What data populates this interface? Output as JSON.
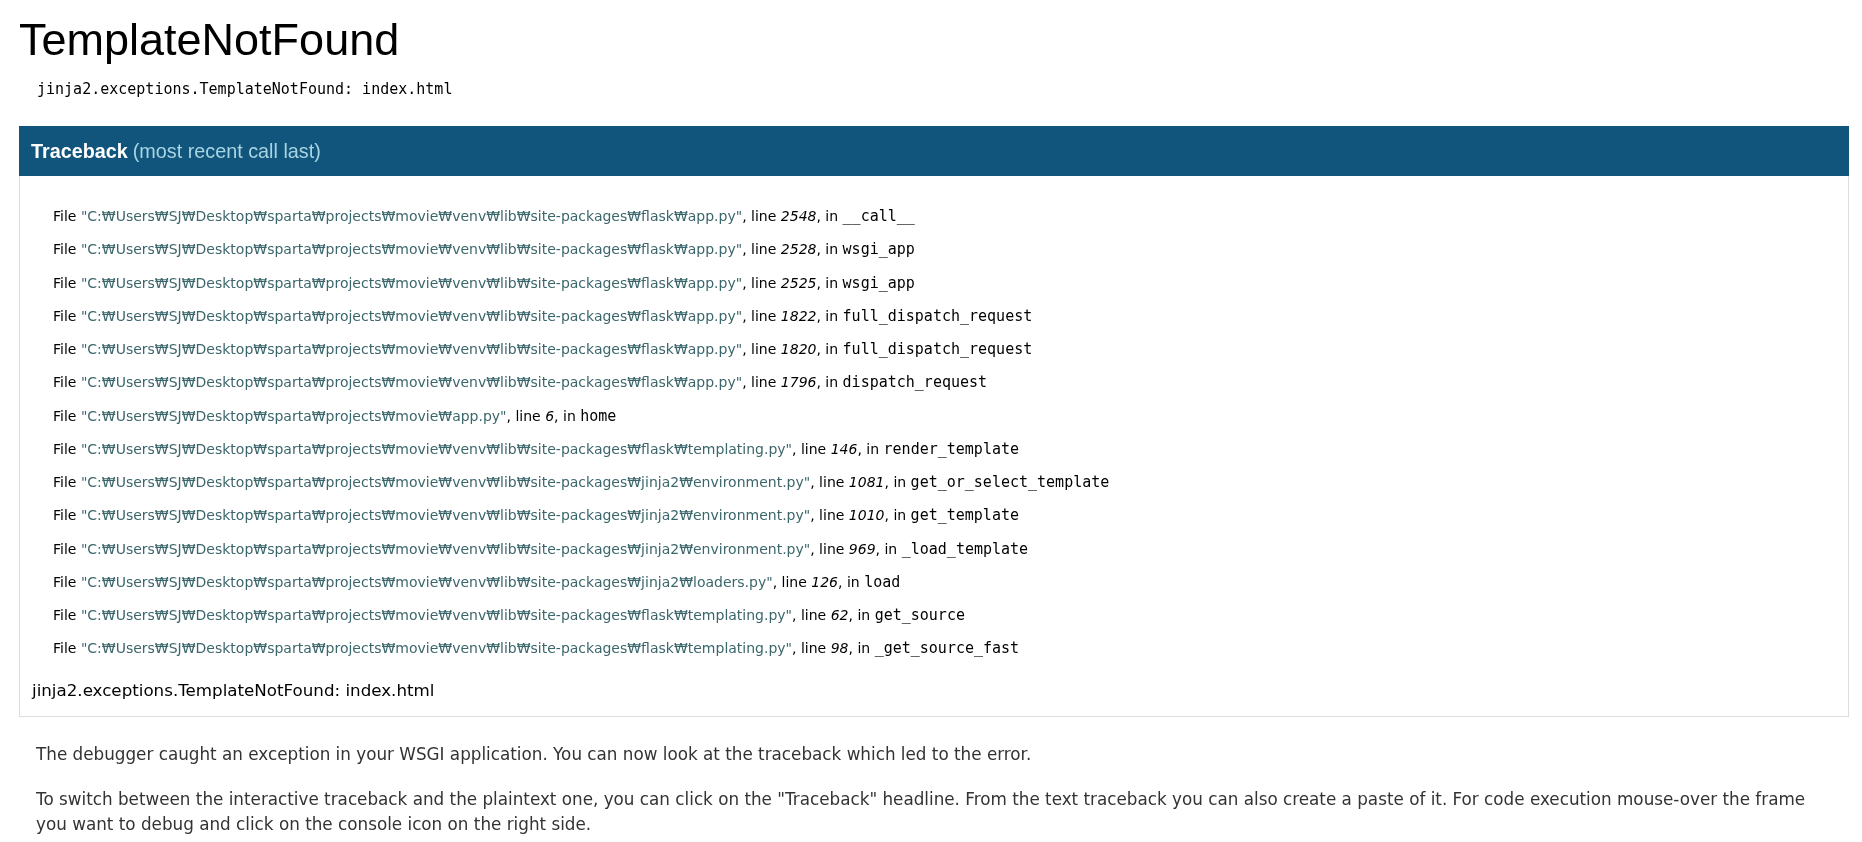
{
  "title": "TemplateNotFound",
  "message": "jinja2.exceptions.TemplateNotFound: index.html",
  "traceback": {
    "heading": "Traceback",
    "heading_note": "(most recent call last)",
    "frames": [
      {
        "file_label": "File",
        "path": "\"C:₩Users₩SJ₩Desktop₩sparta₩projects₩movie₩venv₩lib₩site-packages₩flask₩app.py\"",
        "line_label": ", line",
        "line": "2548",
        "in_label": ", in",
        "function": "__call__"
      },
      {
        "file_label": "File",
        "path": "\"C:₩Users₩SJ₩Desktop₩sparta₩projects₩movie₩venv₩lib₩site-packages₩flask₩app.py\"",
        "line_label": ", line",
        "line": "2528",
        "in_label": ", in",
        "function": "wsgi_app"
      },
      {
        "file_label": "File",
        "path": "\"C:₩Users₩SJ₩Desktop₩sparta₩projects₩movie₩venv₩lib₩site-packages₩flask₩app.py\"",
        "line_label": ", line",
        "line": "2525",
        "in_label": ", in",
        "function": "wsgi_app"
      },
      {
        "file_label": "File",
        "path": "\"C:₩Users₩SJ₩Desktop₩sparta₩projects₩movie₩venv₩lib₩site-packages₩flask₩app.py\"",
        "line_label": ", line",
        "line": "1822",
        "in_label": ", in",
        "function": "full_dispatch_request"
      },
      {
        "file_label": "File",
        "path": "\"C:₩Users₩SJ₩Desktop₩sparta₩projects₩movie₩venv₩lib₩site-packages₩flask₩app.py\"",
        "line_label": ", line",
        "line": "1820",
        "in_label": ", in",
        "function": "full_dispatch_request"
      },
      {
        "file_label": "File",
        "path": "\"C:₩Users₩SJ₩Desktop₩sparta₩projects₩movie₩venv₩lib₩site-packages₩flask₩app.py\"",
        "line_label": ", line",
        "line": "1796",
        "in_label": ", in",
        "function": "dispatch_request"
      },
      {
        "file_label": "File",
        "path": "\"C:₩Users₩SJ₩Desktop₩sparta₩projects₩movie₩app.py\"",
        "line_label": ", line",
        "line": "6",
        "in_label": ", in",
        "function": "home"
      },
      {
        "file_label": "File",
        "path": "\"C:₩Users₩SJ₩Desktop₩sparta₩projects₩movie₩venv₩lib₩site-packages₩flask₩templating.py\"",
        "line_label": ", line",
        "line": "146",
        "in_label": ", in",
        "function": "render_template"
      },
      {
        "file_label": "File",
        "path": "\"C:₩Users₩SJ₩Desktop₩sparta₩projects₩movie₩venv₩lib₩site-packages₩jinja2₩environment.py\"",
        "line_label": ", line",
        "line": "1081",
        "in_label": ", in",
        "function": "get_or_select_template"
      },
      {
        "file_label": "File",
        "path": "\"C:₩Users₩SJ₩Desktop₩sparta₩projects₩movie₩venv₩lib₩site-packages₩jinja2₩environment.py\"",
        "line_label": ", line",
        "line": "1010",
        "in_label": ", in",
        "function": "get_template"
      },
      {
        "file_label": "File",
        "path": "\"C:₩Users₩SJ₩Desktop₩sparta₩projects₩movie₩venv₩lib₩site-packages₩jinja2₩environment.py\"",
        "line_label": ", line",
        "line": "969",
        "in_label": ", in",
        "function": "_load_template"
      },
      {
        "file_label": "File",
        "path": "\"C:₩Users₩SJ₩Desktop₩sparta₩projects₩movie₩venv₩lib₩site-packages₩jinja2₩loaders.py\"",
        "line_label": ", line",
        "line": "126",
        "in_label": ", in",
        "function": "load"
      },
      {
        "file_label": "File",
        "path": "\"C:₩Users₩SJ₩Desktop₩sparta₩projects₩movie₩venv₩lib₩site-packages₩flask₩templating.py\"",
        "line_label": ", line",
        "line": "62",
        "in_label": ", in",
        "function": "get_source"
      },
      {
        "file_label": "File",
        "path": "\"C:₩Users₩SJ₩Desktop₩sparta₩projects₩movie₩venv₩lib₩site-packages₩flask₩templating.py\"",
        "line_label": ", line",
        "line": "98",
        "in_label": ", in",
        "function": "_get_source_fast"
      }
    ],
    "exception": "jinja2.exceptions.TemplateNotFound: index.html"
  },
  "explanation": [
    "The debugger caught an exception in your WSGI application. You can now look at the traceback which led to the error.",
    "To switch between the interactive traceback and the plaintext one, you can click on the \"Traceback\" headline. From the text traceback you can also create a paste of it. For code execution mouse-over the frame you want to debug and click on the console icon on the right side."
  ]
}
